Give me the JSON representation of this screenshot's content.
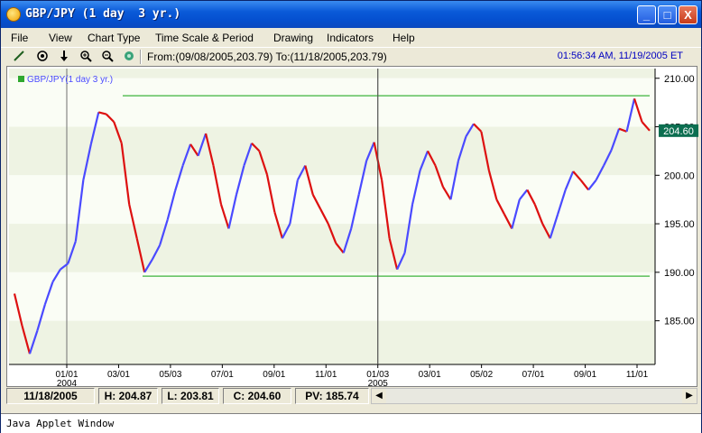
{
  "window": {
    "title": "GBP/JPY (1 day  3 yr.)",
    "min": "_",
    "max": "□",
    "close": "X"
  },
  "menu": [
    "File",
    "View",
    "Chart Type",
    "Time Scale & Period",
    "Drawing",
    "Indicators",
    "Help"
  ],
  "toolbar": {
    "icons": [
      "line-tool-icon",
      "target-tool-icon",
      "down-arrow-icon",
      "zoom-in-icon",
      "zoom-out-icon",
      "hand-icon"
    ],
    "range_text": "From:(09/08/2005,203.79) To:(11/18/2005,203.79)",
    "clock": "01:56:34 AM, 11/19/2005 ET"
  },
  "legend": "GBP/JPY(1 day  3 yr.)",
  "colors": {
    "up": "#4a4aff",
    "down": "#dd1010",
    "channel": "#3cb43c",
    "price_box": "#0c6e50",
    "band": "#eef3e3"
  },
  "chart_data": {
    "type": "line",
    "ylim": [
      180.5,
      211
    ],
    "yticks": [
      "210.00",
      "205.00",
      "200.00",
      "195.00",
      "190.00",
      "185.00"
    ],
    "xticks": [
      "01/01",
      "03/01",
      "05/03",
      "07/01",
      "09/01",
      "11/01",
      "01/03",
      "03/01",
      "05/02",
      "07/01",
      "09/01",
      "11/01"
    ],
    "year_labels": [
      "2004",
      "2005"
    ],
    "current_price": "204.60",
    "channel": {
      "upper": 208.2,
      "lower": 189.6
    },
    "series": [
      {
        "values": [
          187.8,
          184.5,
          181.6,
          184.0,
          186.7,
          189.0,
          190.3,
          190.9,
          193.2,
          199.5,
          203.2,
          206.5,
          206.3,
          205.5,
          203.3,
          197.0,
          193.5,
          190.0,
          191.3,
          192.8,
          195.4,
          198.4,
          201.0,
          203.2,
          202.0,
          204.3,
          201.0,
          197.0,
          194.5,
          198.0,
          201.0,
          203.3,
          202.5,
          200.1,
          196.2,
          193.5,
          195.0,
          199.5,
          201.0,
          198.0,
          196.5,
          195.0,
          193.0,
          192.0,
          194.5,
          198.0,
          201.5,
          203.4,
          199.5,
          193.5,
          190.3,
          192.0,
          197.0,
          200.5,
          202.5,
          201.0,
          198.8,
          197.5,
          201.5,
          204.0,
          205.3,
          204.5,
          200.5,
          197.5,
          196.0,
          194.5,
          197.5,
          198.5,
          197.0,
          195.0,
          193.5,
          196.0,
          198.5,
          200.4,
          199.5,
          198.5,
          199.5,
          201.0,
          202.6,
          204.8,
          204.5,
          207.9,
          205.5,
          204.6
        ]
      }
    ]
  },
  "status": {
    "date": "11/18/2005",
    "high": "H: 204.87",
    "low": "L: 203.81",
    "close": "C: 204.60",
    "pv": "PV: 185.74"
  },
  "footer": "Java Applet Window"
}
